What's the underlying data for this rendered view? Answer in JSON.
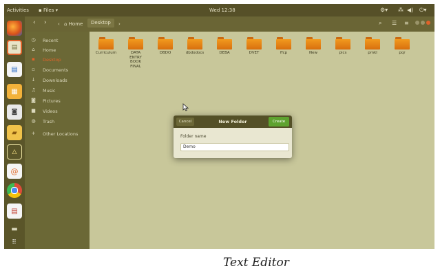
{
  "topbar": {
    "activities": "Activities",
    "app_menu": "Files",
    "clock": "Wed 12:38",
    "tray_icons": [
      "settings-icon",
      "network-icon",
      "volume-icon",
      "power-icon"
    ]
  },
  "launcher": {
    "icons": [
      "firefox-icon",
      "files-icon",
      "document-icon",
      "spreadsheet-icon",
      "camera-icon",
      "folder-icon",
      "software-icon",
      "help-icon",
      "chrome-icon",
      "text-editor-icon",
      "drive-icon",
      "app-grid-icon"
    ]
  },
  "header": {
    "back": "‹",
    "forward": "›",
    "home_label": "Home",
    "current_label": "Desktop",
    "tool_icons": [
      "search-icon",
      "view-list-icon",
      "menu-icon"
    ]
  },
  "sidebar": {
    "items": [
      {
        "label": "Recent",
        "icon": "recent-icon",
        "glyph": "◷",
        "active": false
      },
      {
        "label": "Home",
        "icon": "home-icon",
        "glyph": "⌂",
        "active": false
      },
      {
        "label": "Desktop",
        "icon": "desktop-icon",
        "glyph": "▪",
        "active": true
      },
      {
        "label": "Documents",
        "icon": "documents-icon",
        "glyph": "▫",
        "active": false
      },
      {
        "label": "Downloads",
        "icon": "downloads-icon",
        "glyph": "↓",
        "active": false
      },
      {
        "label": "Music",
        "icon": "music-icon",
        "glyph": "♫",
        "active": false
      },
      {
        "label": "Pictures",
        "icon": "pictures-icon",
        "glyph": "◙",
        "active": false
      },
      {
        "label": "Videos",
        "icon": "videos-icon",
        "glyph": "■",
        "active": false
      },
      {
        "label": "Trash",
        "icon": "trash-icon",
        "glyph": "◍",
        "active": false
      },
      {
        "label": "Other Locations",
        "icon": "other-locations-icon",
        "glyph": "+",
        "active": false
      }
    ]
  },
  "files": [
    {
      "label": "Curriculum"
    },
    {
      "label": "DATA\nENTRY\nBOOK\nFINAL"
    },
    {
      "label": "DBDO"
    },
    {
      "label": "dbdodocs"
    },
    {
      "label": "DEBA"
    },
    {
      "label": "DVET"
    },
    {
      "label": "ffcp"
    },
    {
      "label": "New"
    },
    {
      "label": "pics"
    },
    {
      "label": "pmkl"
    },
    {
      "label": "pqr"
    }
  ],
  "dialog": {
    "title": "New Folder",
    "cancel_label": "Cancel",
    "create_label": "Create",
    "field_label": "Folder name",
    "field_value": "Demo"
  },
  "caption": "Text Editor",
  "colors": {
    "desktop_bg": "#c9c89b",
    "topbar": "#565028",
    "launcher": "#5a5529",
    "sidebar": "#6b6836",
    "active_item": "#e0622a",
    "create_button": "#5ea22f",
    "folder_orange": "#f29a1e"
  }
}
